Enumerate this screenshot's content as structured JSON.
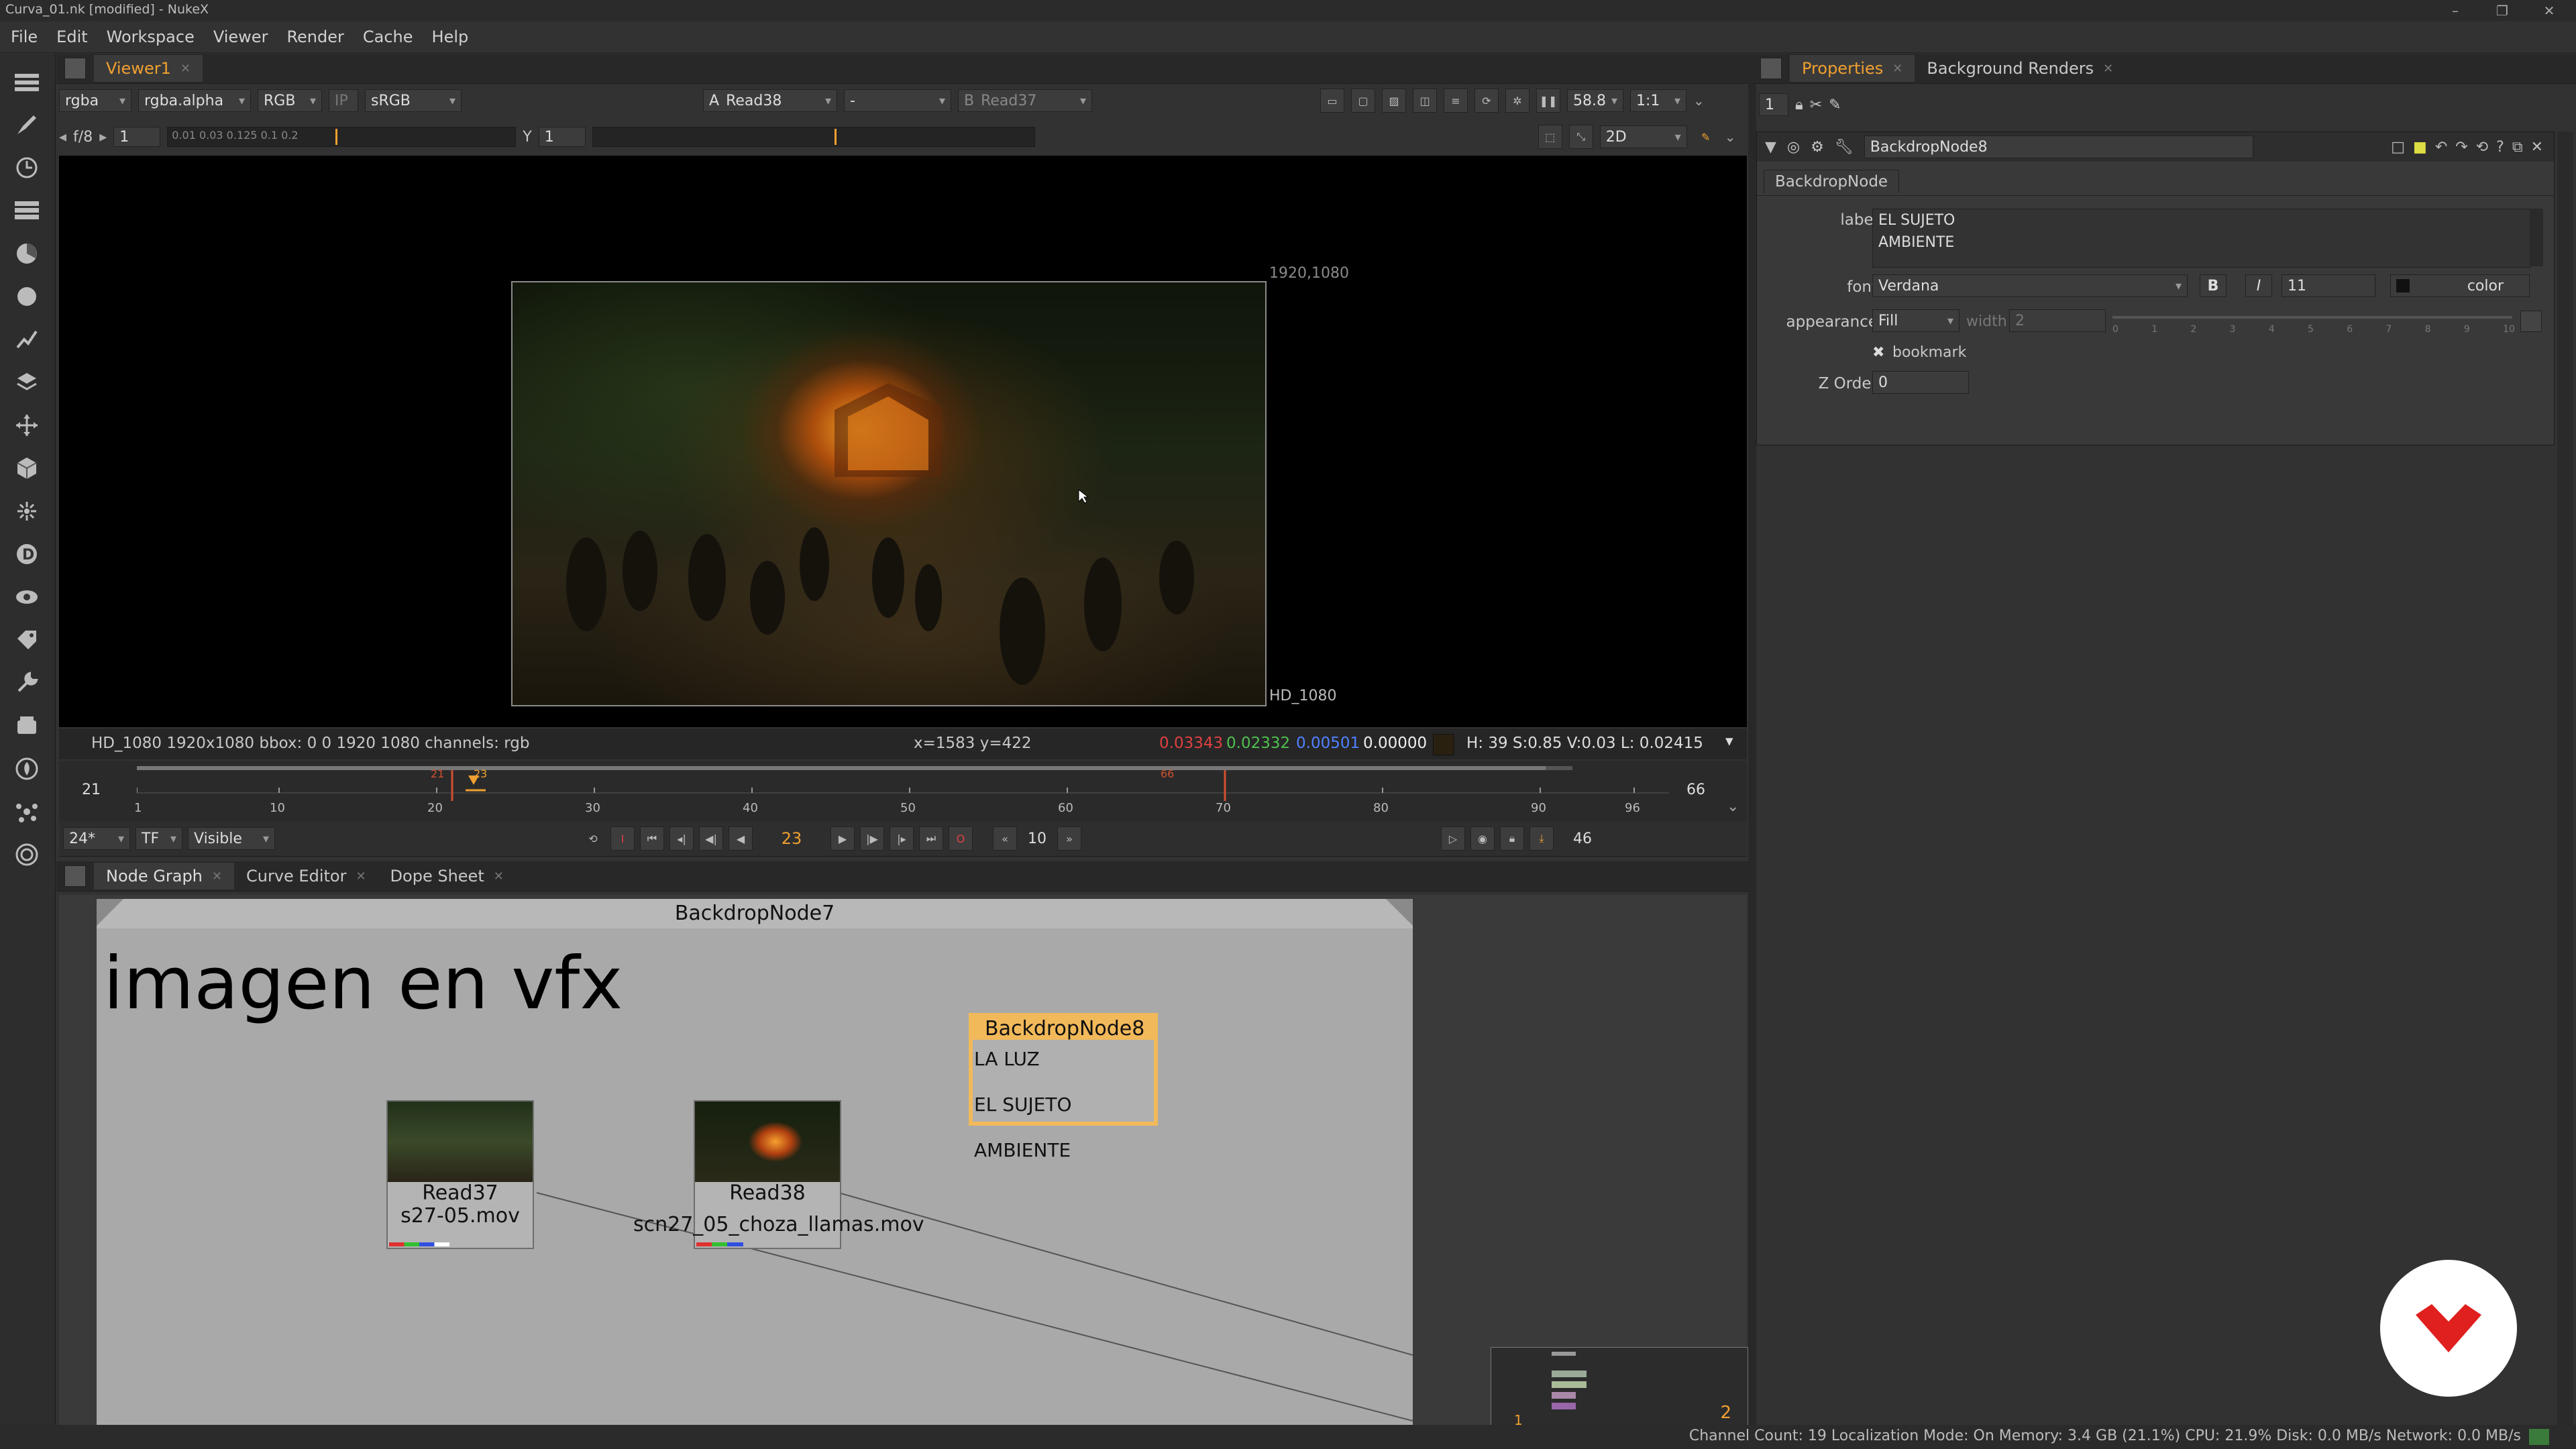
{
  "window": {
    "title": "Curva_01.nk [modified] - NukeX",
    "minimize": "–",
    "maximize": "❐",
    "close": "✕"
  },
  "menu": [
    "File",
    "Edit",
    "Workspace",
    "Viewer",
    "Render",
    "Cache",
    "Help"
  ],
  "viewer": {
    "tab": "Viewer1",
    "channels": "rgba",
    "alpha": "rgba.alpha",
    "display": "RGB",
    "ip": "IP",
    "lut": "sRGB",
    "input_a_letter": "A",
    "input_a": "Read38",
    "wipe": "-",
    "input_b_letter": "B",
    "input_b": "Read37",
    "zoom": "58.8",
    "ratio": "1:1",
    "fstop": "f/8",
    "gain": "1",
    "gamma_label": "Y",
    "gamma": "1",
    "gain_ticks": "0.01 0.03 0.125  0.1  0.2",
    "view_mode": "2D",
    "format_corner": "1920,1080",
    "format_name": "HD_1080",
    "info_format": "HD_1080 1920x1080  bbox: 0 0 1920 1080 channels: rgb",
    "info_pos": "x=1583 y=422",
    "info_r": "0.03343",
    "info_g": "0.02332",
    "info_b": "0.00501",
    "info_a": "0.00000",
    "info_hsv": "H: 39 S:0.85 V:0.03  L: 0.02415",
    "swatch_color": "#2a2010"
  },
  "timeline": {
    "in_frame": "21",
    "out_frame": "66",
    "marker_in": "21",
    "current_marker": "23",
    "marker_out": "66",
    "ticks": [
      "1",
      "10",
      "20",
      "30",
      "40",
      "50",
      "60",
      "70",
      "80",
      "90",
      "96"
    ],
    "fps": "24*",
    "tf": "TF",
    "visible": "Visible",
    "current_frame": "23",
    "step": "10",
    "end_count": "46"
  },
  "nodegraph": {
    "tabs": [
      "Node Graph",
      "Curve Editor",
      "Dope Sheet"
    ],
    "backdrop7_title": "BackdropNode7",
    "backdrop7_label": "imagen en vfx",
    "backdrop8_title": "BackdropNode8",
    "backdrop8_line1": "LA LUZ",
    "backdrop8_line2": "EL SUJETO",
    "backdrop8_line3": "AMBIENTE",
    "read37_name": "Read37",
    "read37_file": "s27-05.mov",
    "read38_name": "Read38",
    "read38_file": "scn27_05_choza_llamas.mov",
    "minimap_1": "1",
    "minimap_2": "2"
  },
  "properties": {
    "tabs": [
      "Properties",
      "Background Renders"
    ],
    "max_panels": "1",
    "node_name": "BackdropNode8",
    "section_tab": "BackdropNode",
    "label_label": "label",
    "label_line1": "EL SUJETO",
    "label_line2": "AMBIENTE",
    "font_label": "font",
    "font_value": "Verdana",
    "bold": "B",
    "italic": "I",
    "font_size": "11",
    "color_button": "color",
    "appearance_label": "appearance",
    "appearance_value": "Fill",
    "width_label": "width",
    "width_value": "2",
    "slider_ticks": [
      "0",
      "1",
      "2",
      "3",
      "4",
      "5",
      "6",
      "7",
      "8",
      "9",
      "10"
    ],
    "bookmark_label": "bookmark",
    "zorder_label": "Z Order",
    "zorder_value": "0"
  },
  "status": {
    "text": "Channel Count: 19  Localization Mode: On  Memory: 3.4 GB (21.1%)  CPU: 21.9%  Disk: 0.0 MB/s  Network: 0.0 MB/s"
  },
  "colors": {
    "accent": "#f0a030",
    "red": "#e04040",
    "green": "#50c050",
    "blue": "#5080ff",
    "backdrop8": "#f2b95a",
    "logo": "#e0201e"
  }
}
